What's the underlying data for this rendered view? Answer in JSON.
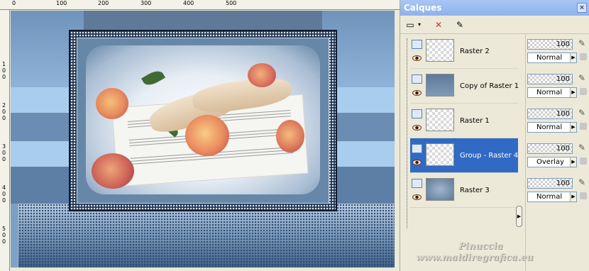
{
  "ruler": {
    "top_labels": [
      "0",
      "100",
      "200",
      "300",
      "400",
      "500"
    ],
    "left_labels": [
      "1\n0\n0",
      "2\n0\n0",
      "3\n0\n0",
      "4\n0\n0",
      "5\n0\n0"
    ]
  },
  "palette": {
    "title": "Calques",
    "close_glyph": "×",
    "layers": [
      {
        "name": "Raster 2",
        "opacity": "100",
        "blend": "Normal",
        "selected": false
      },
      {
        "name": "Copy of Raster 1",
        "opacity": "100",
        "blend": "Normal",
        "selected": false
      },
      {
        "name": "Raster 1",
        "opacity": "100",
        "blend": "Normal",
        "selected": false
      },
      {
        "name": "Group - Raster 4",
        "opacity": "100",
        "blend": "Overlay",
        "selected": true
      },
      {
        "name": "Raster 3",
        "opacity": "100",
        "blend": "Normal",
        "selected": false
      }
    ]
  },
  "watermark": {
    "line1": "Pinuccia",
    "line2": "www.maldiregrafica.eu"
  },
  "colors": {
    "selected": "#316ac5",
    "titlebar": "#8fb2ec",
    "canvas_blue": "#6d8fb4"
  }
}
